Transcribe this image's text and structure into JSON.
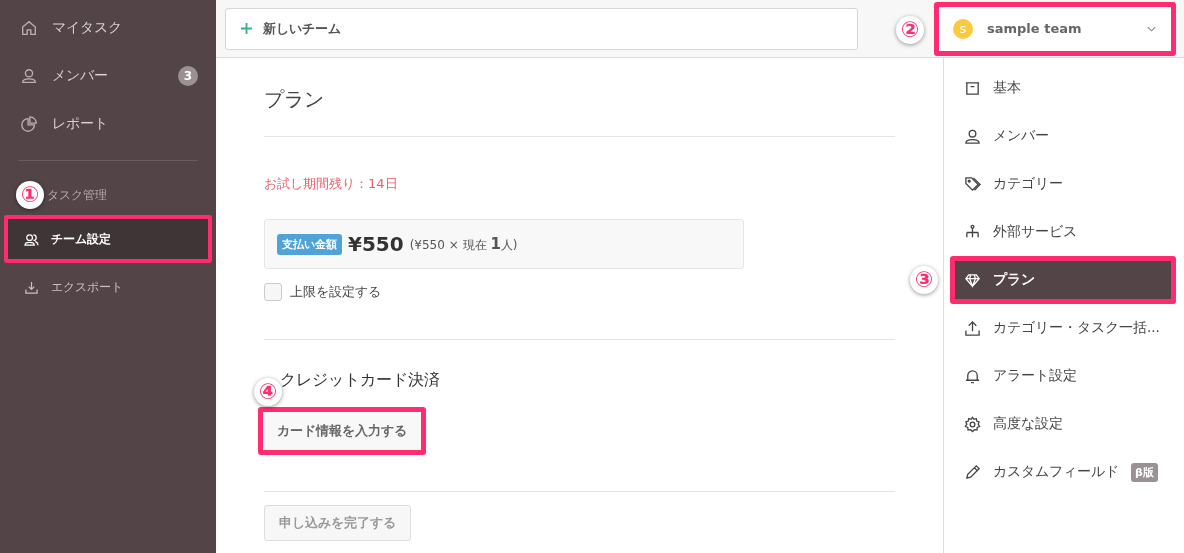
{
  "sidebar": {
    "items": [
      {
        "label": "マイタスク",
        "selected": false
      },
      {
        "label": "メンバー",
        "badge": "3",
        "selected": false
      },
      {
        "label": "レポート",
        "selected": false
      }
    ],
    "section": {
      "title": "タスク管理",
      "callout": "①",
      "items": [
        {
          "label": "チーム設定",
          "selected": true,
          "highlighted": true
        },
        {
          "label": "エクスポート",
          "selected": false,
          "highlighted": false
        }
      ]
    }
  },
  "topbar": {
    "new_team_button": "新しいチーム",
    "team": {
      "initial": "s",
      "name": "sample team",
      "callout": "②",
      "highlighted": true
    }
  },
  "plan": {
    "title": "プラン",
    "trial_notice": "お試し期間残り：14日",
    "amount": {
      "tag": "支払い金額",
      "price": "¥550",
      "detail": "(¥550 × 現在 **1**人)"
    },
    "limit_checkbox": {
      "label": "上限を設定する",
      "checked": false
    }
  },
  "payment": {
    "title": "クレジットカード決済",
    "callout": "④",
    "card_button": {
      "label": "カード情報を入力する",
      "highlighted": true
    },
    "submit_button": {
      "label": "申し込みを完了する",
      "disabled": true
    }
  },
  "settings_menu": {
    "items": [
      {
        "label": "基本",
        "selected": false,
        "highlighted": false
      },
      {
        "label": "メンバー",
        "selected": false,
        "highlighted": false
      },
      {
        "label": "カテゴリー",
        "selected": false,
        "highlighted": false
      },
      {
        "label": "外部サービス",
        "selected": false,
        "highlighted": false
      },
      {
        "label": "プラン",
        "selected": true,
        "highlighted": true,
        "callout": "③"
      },
      {
        "label": "カテゴリー・タスク一括...",
        "selected": false,
        "highlighted": false
      },
      {
        "label": "アラート設定",
        "selected": false,
        "highlighted": false
      },
      {
        "label": "高度な設定",
        "selected": false,
        "highlighted": false
      },
      {
        "label": "カスタムフィールド",
        "badge": "β版",
        "selected": false,
        "highlighted": false
      }
    ]
  }
}
